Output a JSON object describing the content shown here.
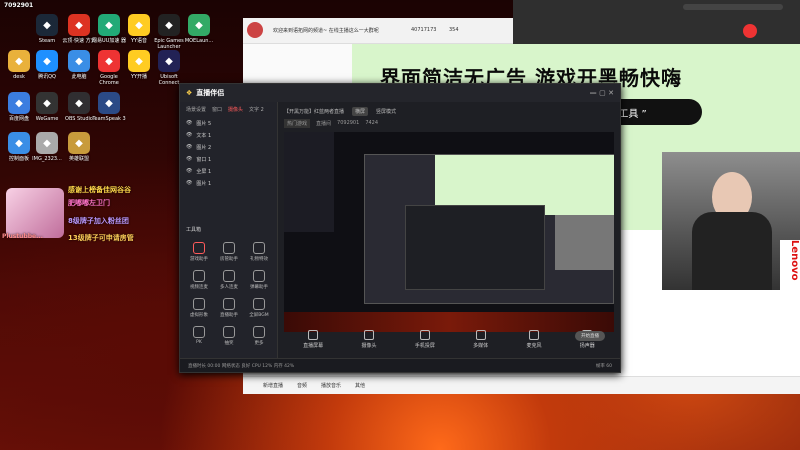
{
  "desktop": {
    "top_id": "7092901",
    "icons": [
      {
        "label": "Steam",
        "icon": "steam-icon",
        "color": "#1b2838"
      },
      {
        "label": "云顶·快速\n方式",
        "icon": "app-icon",
        "color": "#d32"
      },
      {
        "label": "网易UU加速\n器",
        "icon": "uu-icon",
        "color": "#2a7"
      },
      {
        "label": "YY语音",
        "icon": "yy-icon",
        "color": "#fc2"
      },
      {
        "label": "Epic Games\nLauncher",
        "icon": "epic-icon",
        "color": "#222"
      },
      {
        "label": "MOELaun...",
        "icon": "moe-icon",
        "color": "#3a6"
      },
      {
        "label": "desk",
        "icon": "folder-icon",
        "color": "#e9b13b"
      },
      {
        "label": "腾讯QQ",
        "icon": "qq-icon",
        "color": "#1e90ff"
      },
      {
        "label": "此电脑",
        "icon": "computer-icon",
        "color": "#3a8ee6"
      },
      {
        "label": "Google\nChrome",
        "icon": "chrome-icon",
        "color": "#e33"
      },
      {
        "label": "YY开播",
        "icon": "yy-live-icon",
        "color": "#fc2"
      },
      {
        "label": "Ubisoft\nConnect",
        "icon": "ubisoft-icon",
        "color": "#225"
      },
      {
        "label": "百度网盘",
        "icon": "baidu-icon",
        "color": "#3b7de0"
      },
      {
        "label": "WeGame",
        "icon": "wegame-icon",
        "color": "#333"
      },
      {
        "label": "OBS Studio",
        "icon": "obs-icon",
        "color": "#302e31"
      },
      {
        "label": "TeamSpeak\n3",
        "icon": "teamspeak-icon",
        "color": "#2b4a86"
      },
      {
        "label": "控制面板",
        "icon": "control-icon",
        "color": "#3a8ee6"
      },
      {
        "label": "IMG_2323...",
        "icon": "image-icon",
        "color": "#aaa"
      },
      {
        "label": "英雄联盟",
        "icon": "lol-icon",
        "color": "#c89b3c"
      }
    ],
    "left_side_labels": [
      "英雄联盟\nWeGame",
      "Plustubbe..."
    ],
    "overlay_texts": [
      {
        "text": "感谢上榜备佳网谷谷",
        "color": "#ffd84a"
      },
      {
        "text": "肥嘟嘟左卫门",
        "color": "#ff73c7"
      },
      {
        "text": "8级牌子加入粉丝团",
        "color": "#b9f"
      },
      {
        "text": "13级牌子可申请房管",
        "color": "#ffcf59"
      }
    ]
  },
  "live_window": {
    "notice": "欢迎来到语拓网的频道~ 在线主播这么一大群呢",
    "viewer_count": "40717173",
    "count2": "354",
    "banner_headline": "界面简洁无广告 游戏开黑畅快嗨",
    "banner_pill": "“ 工具 ”",
    "bottom_items": [
      "新增直播",
      "音频",
      "播放音乐",
      "其他"
    ],
    "side_text": "Lenovo"
  },
  "streaming_app": {
    "title": "直播伴侣",
    "menu_tabs": [
      "场景设置",
      "窗口",
      "摄像头",
      "文字 2"
    ],
    "layers": [
      "图片 5",
      "文本 1",
      "图片 2",
      "窗口 1",
      "全屏 1",
      "图片 1"
    ],
    "tools_header": "工具箱",
    "tools": [
      "游戏助手",
      "房管助手",
      "礼物特效",
      "视频连麦",
      "多人连麦",
      "弹幕助手",
      "虚拟形象",
      "直播助手",
      "全屏BGM",
      "PK",
      "抽奖",
      "更多"
    ],
    "header_tags": [
      "【开黑万能】红蓝两者直播",
      "横屏",
      "竖屏模式"
    ],
    "sub_row": [
      "热门游戏",
      "直播间",
      "7092901",
      "7424"
    ],
    "bottom_controls": [
      "直播屏幕",
      "摄像头",
      "手机投屏",
      "多媒体",
      "麦克风",
      "扬声器"
    ],
    "start_button": "开始直播",
    "status_text": "直播时长 00:00  网络状态 良好  CPU 12%  内存 42%",
    "status_right": "帧率 60"
  }
}
